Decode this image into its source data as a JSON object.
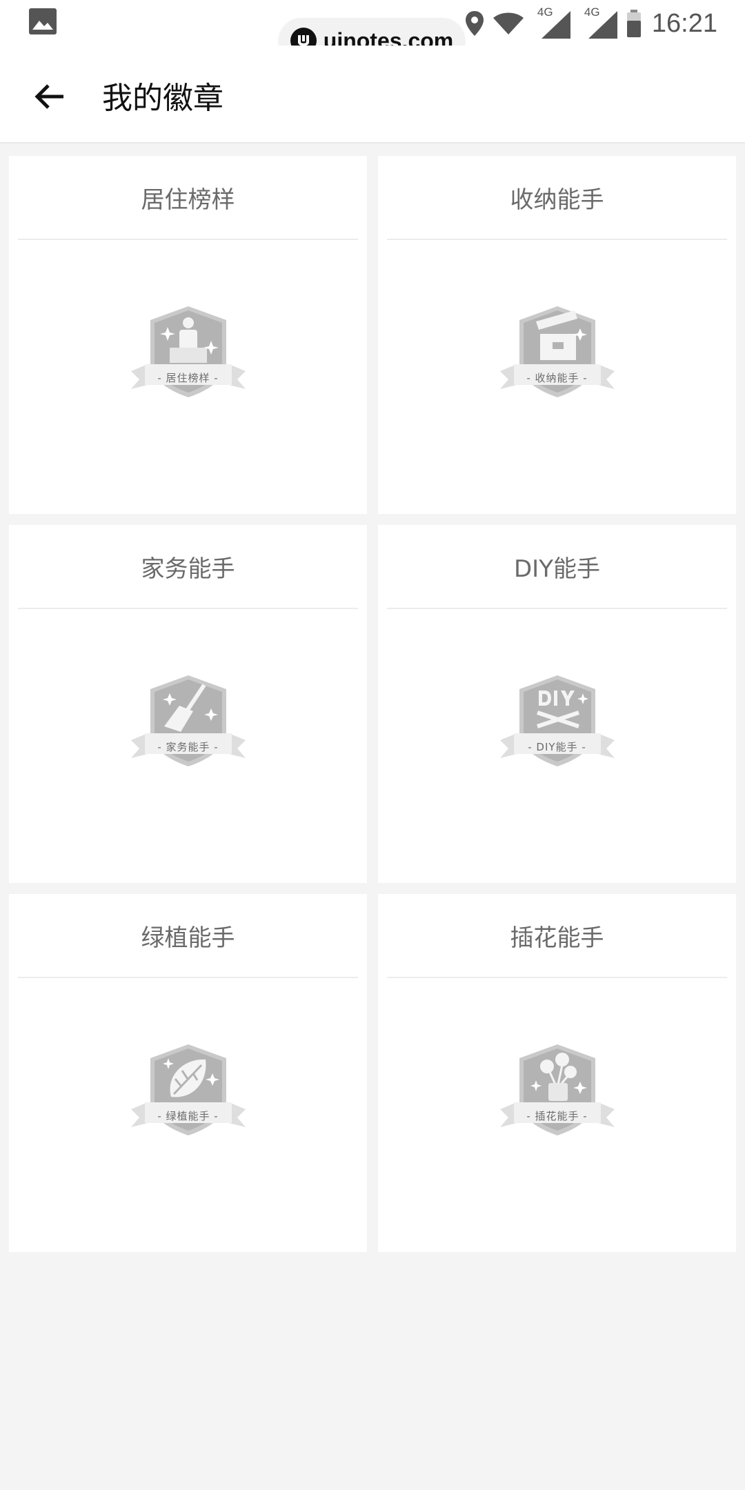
{
  "status_bar": {
    "time": "16:21",
    "network_1": "4G",
    "network_2": "4G",
    "icons": [
      "gallery-icon",
      "location-icon",
      "wifi-icon",
      "signal-icon",
      "signal-icon",
      "battery-icon"
    ]
  },
  "watermark": {
    "text": "uinotes.com"
  },
  "header": {
    "title": "我的徽章",
    "back_icon": "arrow-left-icon"
  },
  "badges": [
    {
      "title": "居住榜样",
      "label": "- 居住榜样 -",
      "icon": "person-podium-icon"
    },
    {
      "title": "收纳能手",
      "label": "- 收纳能手 -",
      "icon": "storage-box-icon"
    },
    {
      "title": "家务能手",
      "label": "- 家务能手 -",
      "icon": "broom-icon"
    },
    {
      "title": "DIY能手",
      "label": "- DIY能手 -",
      "icon": "diy-tools-icon"
    },
    {
      "title": "绿植能手",
      "label": "- 绿植能手 -",
      "icon": "leaf-icon"
    },
    {
      "title": "插花能手",
      "label": "- 插花能手 -",
      "icon": "flower-vase-icon"
    }
  ],
  "colors": {
    "background": "#f4f4f4",
    "card": "#ffffff",
    "badge_gray": "#b5b5b5"
  }
}
